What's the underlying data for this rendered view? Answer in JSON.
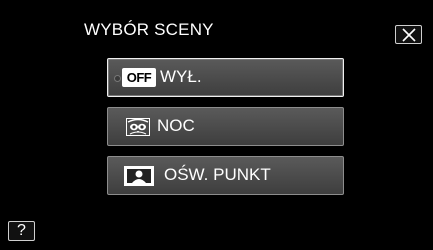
{
  "screen": {
    "title": "WYBÓR SCENY"
  },
  "menu": {
    "items": [
      {
        "icon": "off-icon",
        "icon_text": "OFF",
        "label": "WYŁ.",
        "selected": true
      },
      {
        "icon": "night-icon",
        "label": "NOC",
        "selected": false
      },
      {
        "icon": "spotlight-icon",
        "label": "OŚW. PUNKT",
        "selected": false
      }
    ]
  },
  "buttons": {
    "close_icon": "close-icon",
    "help_label": "?"
  },
  "colors": {
    "background": "#000000",
    "item_fill": "#4a4a4a",
    "item_border": "#8d8d8d",
    "selected_border": "#f0f0f0",
    "text": "#ffffff"
  }
}
